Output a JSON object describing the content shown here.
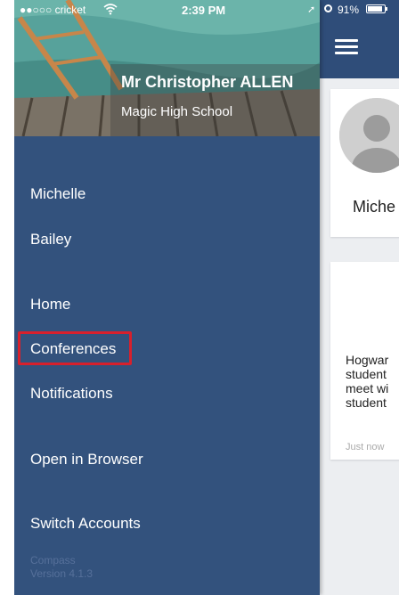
{
  "status_bar": {
    "carrier": "●●○○○ cricket",
    "time": "2:39 PM",
    "battery": "91%",
    "battery_level": 0.91
  },
  "drawer": {
    "user_name": "Mr Christopher ALLEN",
    "school": "Magic High School",
    "menu": {
      "michelle": "Michelle",
      "bailey": "Bailey",
      "home": "Home",
      "conferences": "Conferences",
      "notifications": "Notifications",
      "open_browser": "Open in Browser",
      "switch_accounts": "Switch Accounts"
    },
    "app_name": "Compass",
    "version": "Version 4.1.3"
  },
  "main": {
    "profile_name": "Miche",
    "notice_lines": [
      "Hogwar",
      "student",
      "meet wi",
      "student"
    ],
    "notice_time": "Just now"
  },
  "colors": {
    "drawer_bg": "#33527d",
    "topbar_bg": "#2f4d79",
    "highlight": "#d8202c"
  },
  "icons": {
    "menu": "hamburger-icon",
    "wifi": "wifi-icon",
    "location": "location-arrow-icon",
    "lock": "orientation-lock-icon",
    "battery": "battery-icon",
    "avatar": "default-avatar-icon"
  }
}
